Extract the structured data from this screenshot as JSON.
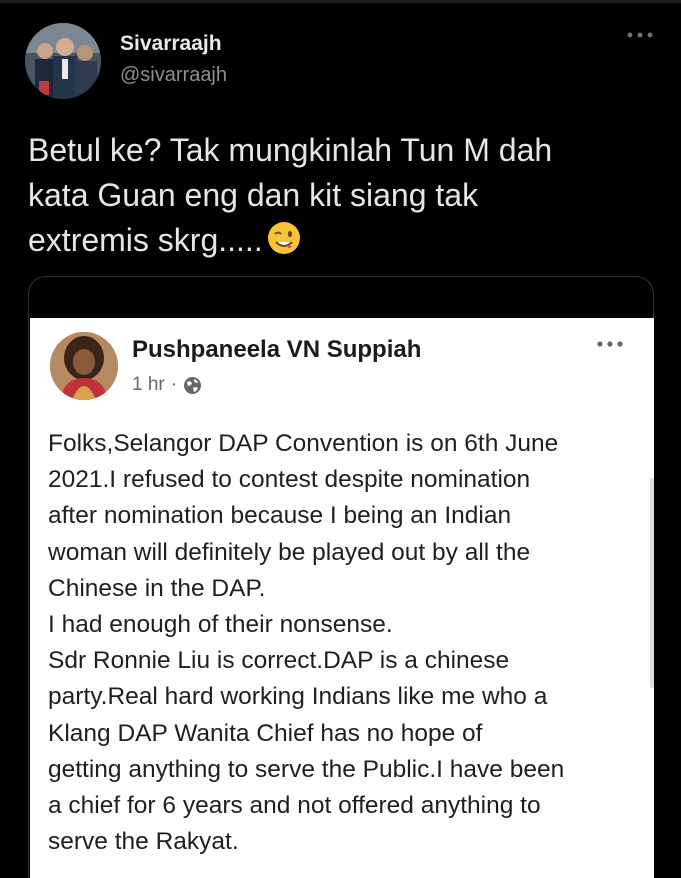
{
  "tweet": {
    "author": {
      "display_name": "Sivarraajh",
      "handle": "@sivarraajh",
      "avatar_icon": "user-photo-avatar"
    },
    "more_icon": "more-horizontal-icon",
    "text_lines": [
      "Betul ke? Tak mungkinlah Tun M dah",
      "kata Guan eng dan kit siang tak",
      "extremis skrg....."
    ],
    "emoji": "winking-face-with-tongue-emoji"
  },
  "embedded_post": {
    "author_name": "Pushpaneela VN Suppiah",
    "timestamp": "1 hr",
    "separator": "·",
    "privacy_icon": "globe-icon",
    "more_icon": "more-horizontal-icon",
    "body_lines": [
      "Folks,Selangor DAP Convention is on 6th June",
      "2021.I refused to contest despite nomination",
      "after nomination because I being an Indian",
      "woman will definitely be played out by all the",
      "Chinese in the DAP.",
      "I had enough of  their nonsense.",
      "Sdr Ronnie Liu is  correct.DAP is a chinese",
      "party.Real hard working Indians like me who a",
      "Klang DAP Wanita Chief has no hope  of",
      "getting anything to serve the Public.I have been",
      "a chief for 6 years and not offered anything to",
      "serve the Rakyat."
    ]
  },
  "colors": {
    "background": "#000000",
    "tweet_text": "#e6e6e6",
    "handle": "#8b9096",
    "card_border": "#2f3336",
    "fb_background": "#ffffff",
    "fb_text": "#1f1f1f",
    "fb_meta": "#65676b"
  }
}
